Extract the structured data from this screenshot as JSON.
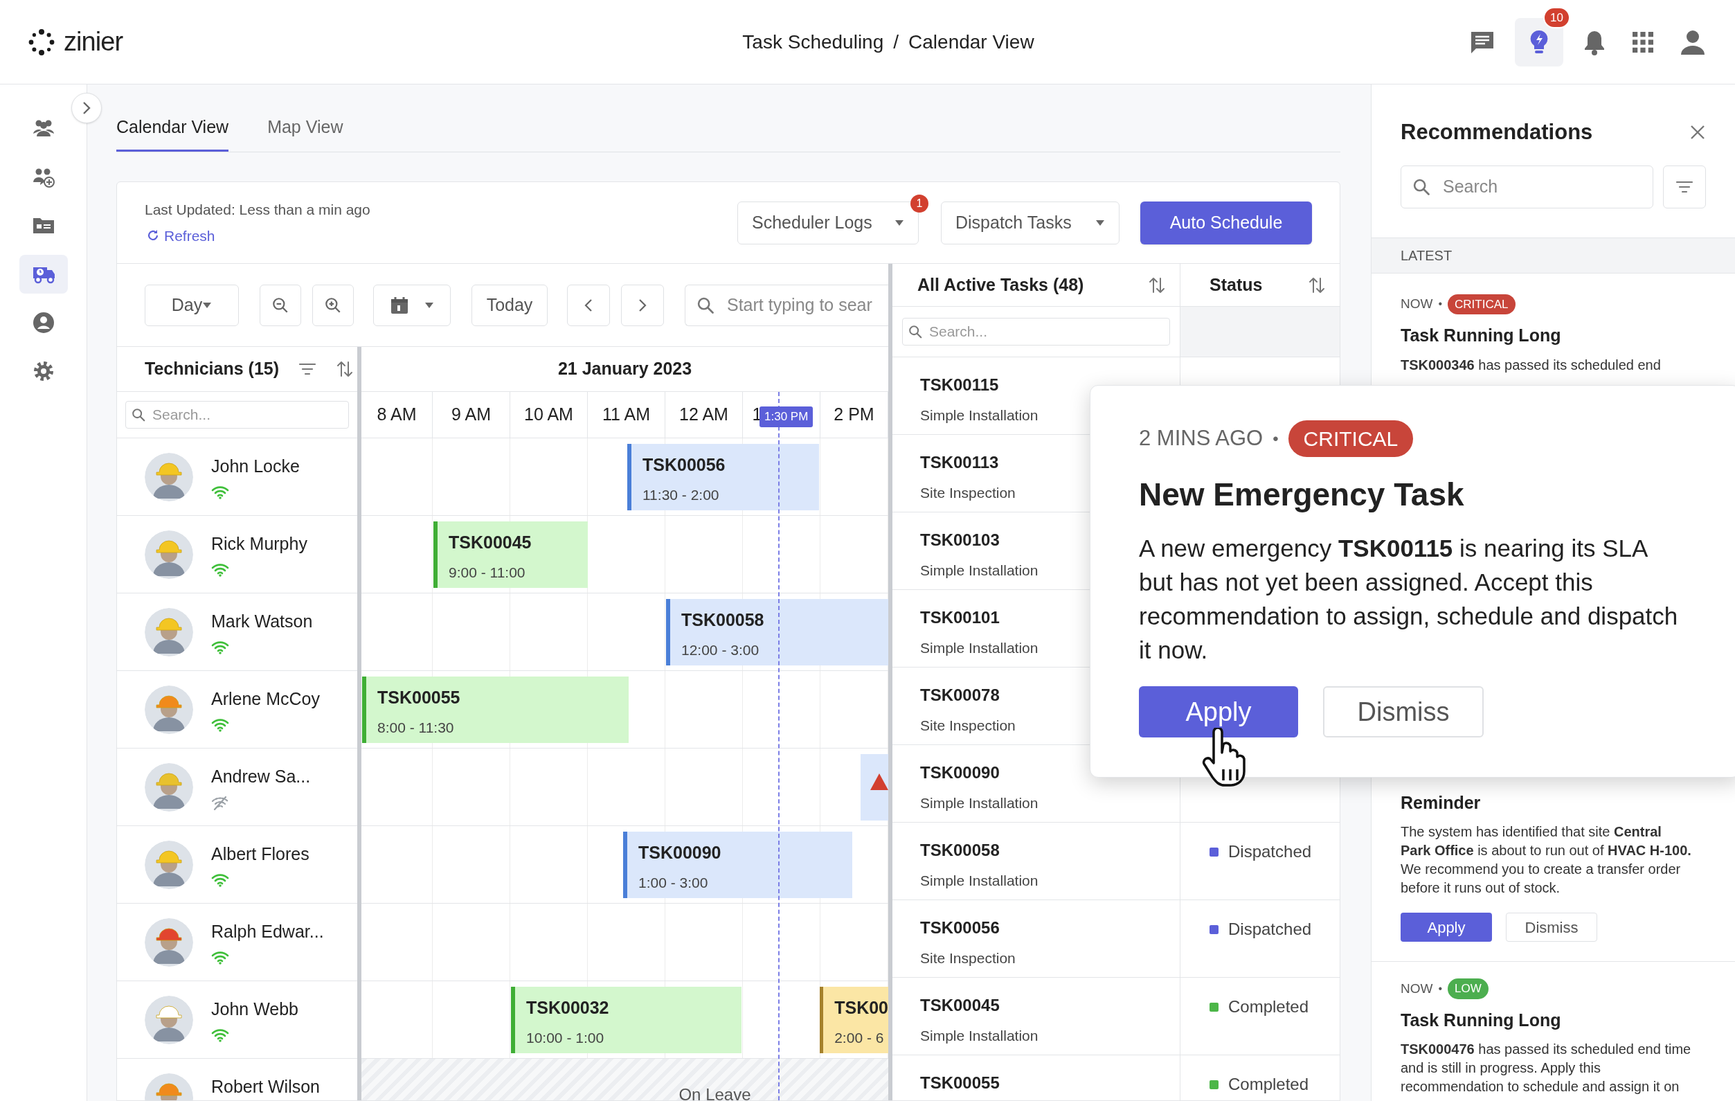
{
  "header": {
    "logo_text": "zinier",
    "breadcrumb": [
      "Task Scheduling",
      "Calendar View"
    ],
    "separator": "/",
    "ideas_badge": "10"
  },
  "nav_items": [
    {
      "selected": false
    },
    {
      "selected": false
    },
    {
      "selected": false
    },
    {
      "selected": true
    },
    {
      "selected": false
    },
    {
      "selected": false
    }
  ],
  "tabs": [
    {
      "label": "Calendar View",
      "selected": true
    },
    {
      "label": "Map View",
      "selected": false
    }
  ],
  "status_line": {
    "last_updated": "Last Updated: Less than a min ago",
    "refresh": "Refresh"
  },
  "actions": {
    "scheduler_logs": "Scheduler Logs",
    "scheduler_logs_badge": "1",
    "dispatch_tasks": "Dispatch Tasks",
    "auto_schedule": "Auto Schedule"
  },
  "calendar_toolbar": {
    "view": "Day",
    "today": "Today",
    "search_placeholder": "Start typing to sear"
  },
  "technicians": {
    "title": "Technicians (15)",
    "search_placeholder": "Search...",
    "rows": [
      {
        "name": "John Locke",
        "online": true,
        "events": [
          {
            "kind": "scheduled",
            "task": "TSK00056",
            "time": "11:30 - 2:00"
          }
        ]
      },
      {
        "name": "Rick Murphy",
        "online": true,
        "events": [
          {
            "kind": "completed",
            "task": "TSK00045",
            "time": "9:00 - 11:00"
          }
        ]
      },
      {
        "name": "Mark Watson",
        "online": true,
        "events": [
          {
            "kind": "scheduled",
            "task": "TSK00058",
            "time": "12:00 - 3:00"
          }
        ]
      },
      {
        "name": "Arlene McCoy",
        "online": true,
        "events": [
          {
            "kind": "completed",
            "task": "TSK00055",
            "time": "8:00 - 11:30"
          }
        ]
      },
      {
        "name": "Andrew Sa...",
        "online": false,
        "events": [
          {
            "kind": "alert"
          }
        ]
      },
      {
        "name": "Albert Flores",
        "online": true,
        "events": [
          {
            "kind": "scheduled",
            "task": "TSK00090",
            "time": "1:00 - 3:00"
          }
        ]
      },
      {
        "name": "Ralph Edwar...",
        "online": true,
        "events": []
      },
      {
        "name": "John Webb",
        "online": true,
        "events": [
          {
            "kind": "completed",
            "task": "TSK00032",
            "time": "10:00 - 1:00"
          },
          {
            "kind": "pending",
            "task": "TSK00",
            "time": "2:00 - 6"
          }
        ]
      },
      {
        "name": "Robert Wilson",
        "leave": "On Leave"
      }
    ]
  },
  "calendar": {
    "date": "21 January 2023",
    "hours": [
      "8 AM",
      "9 AM",
      "10 AM",
      "11 AM",
      "12 AM",
      "1",
      "2 PM"
    ],
    "now_marker": "1:30 PM"
  },
  "tasks": {
    "title": "All Active Tasks (48)",
    "status_title": "Status",
    "search_placeholder": "Search...",
    "rows": [
      {
        "id": "TSK00115",
        "type": "Simple Installation"
      },
      {
        "id": "TSK00113",
        "type": "Site Inspection"
      },
      {
        "id": "TSK00103",
        "type": "Simple Installation"
      },
      {
        "id": "TSK00101",
        "type": "Simple Installation"
      },
      {
        "id": "TSK00078",
        "type": "Site Inspection"
      },
      {
        "id": "TSK00090",
        "type": "Simple Installation"
      },
      {
        "id": "TSK00058",
        "type": "Simple Installation",
        "status": "Dispatched",
        "color": "#5b5fd9"
      },
      {
        "id": "TSK00056",
        "type": "Site Inspection",
        "status": "Dispatched",
        "color": "#5b5fd9"
      },
      {
        "id": "TSK00045",
        "type": "Simple Installation",
        "status": "Completed",
        "color": "#4cb648"
      },
      {
        "id": "TSK00055",
        "status": "Completed",
        "color": "#4cb648"
      }
    ]
  },
  "recommendations": {
    "title": "Recommendations",
    "search_placeholder": "Search",
    "section": "LATEST",
    "cards": [
      {
        "time": "NOW",
        "bullet": "•",
        "severity": "CRITICAL",
        "color": "#c8453a",
        "title": "Task Running Long",
        "body": "**TSK000346** has passed its scheduled end"
      },
      {
        "title": "Reminder",
        "body": "The system has identified that site **Central Park Office** is about to run out of **HVAC H-100.** We recommend you to create a transfer order before it runs out of stock.",
        "apply": "Apply",
        "dismiss": "Dismiss"
      },
      {
        "time": "NOW",
        "bullet": "•",
        "severity": "LOW",
        "color": "#4cae4f",
        "title": "Task Running Long",
        "body": "**TSK000476** has passed its scheduled end time and is still in progress. Apply this recommendation to schedule and assign it on"
      }
    ]
  },
  "popup": {
    "time": "2 MINS AGO",
    "bullet": "•",
    "severity": "CRITICAL",
    "color": "#c8453a",
    "title": "New Emergency Task",
    "body": "A new emergency **TSK00115** is nearing its SLA but has not yet been assigned. Accept this recommendation to assign, schedule and dispatch it now.",
    "apply": "Apply",
    "dismiss": "Dismiss"
  }
}
